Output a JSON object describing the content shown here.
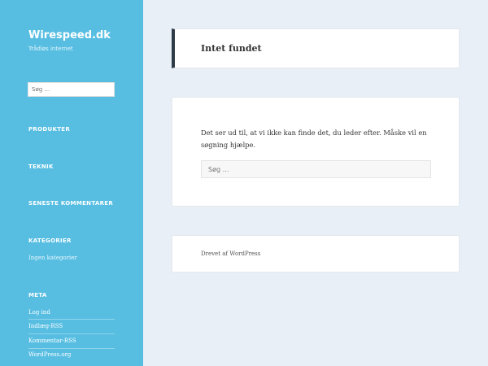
{
  "site": {
    "title": "Wirespeed.dk",
    "description": "Trådløs internet"
  },
  "sidebar": {
    "search_placeholder": "Søg …",
    "widgets": {
      "produkter": "PRODUKTER",
      "teknik": "TEKNIK",
      "seneste": "SENESTE KOMMENTARER",
      "kategorier": "KATEGORIER",
      "kategorier_empty": "Ingen kategorier",
      "meta": "META"
    },
    "meta_links": [
      "Log ind",
      "Indlæg-RSS",
      "Kommentar-RSS",
      "WordPress.org"
    ]
  },
  "main": {
    "page_title": "Intet fundet",
    "message": "Det ser ud til, at vi ikke kan finde det, du leder efter. Måske vil en søgning hjælpe.",
    "search_placeholder": "Søg …"
  },
  "footer": {
    "credit": "Drevet af WordPress"
  },
  "colors": {
    "sidebar_bg": "#57bee2",
    "page_bg": "#e9eff7",
    "header_accent": "#2e3a47"
  }
}
